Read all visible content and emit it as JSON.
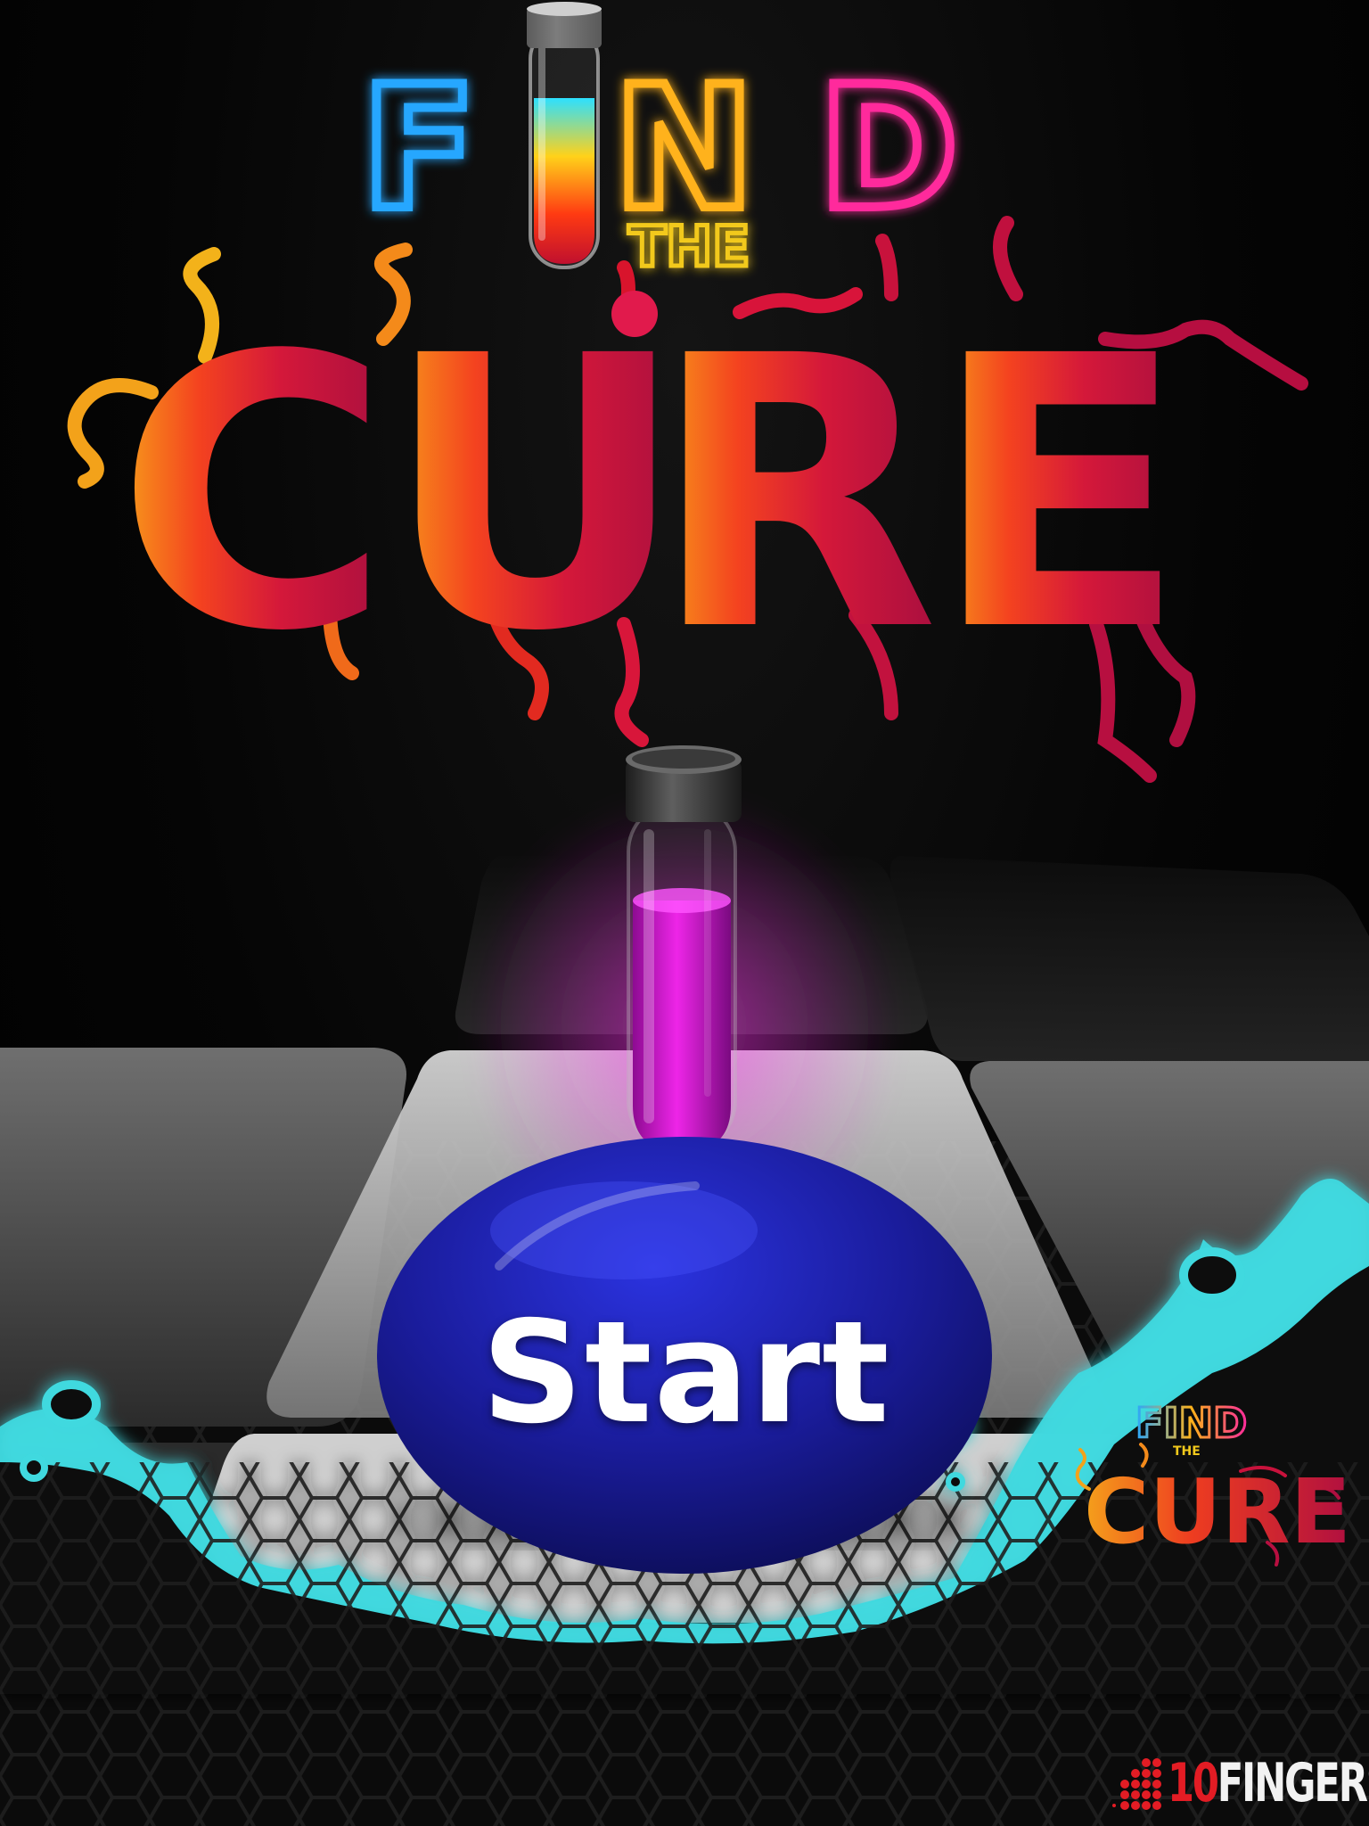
{
  "title": {
    "line1": [
      "F",
      "N",
      "D"
    ],
    "line2": "THE",
    "line3": [
      "C",
      "U",
      "R",
      "E"
    ]
  },
  "start_button": {
    "label": "Start"
  },
  "corner_logo": {
    "line1": "FIND",
    "line2": "THE",
    "line3": "CURE"
  },
  "brand": {
    "number": "10",
    "name": "FINGERS"
  },
  "colors": {
    "vial_liquid": "#d81bd6",
    "start_button": "#1b1ea6",
    "splash_glow": "#45e6ec",
    "brand_red": "#e31c24"
  }
}
